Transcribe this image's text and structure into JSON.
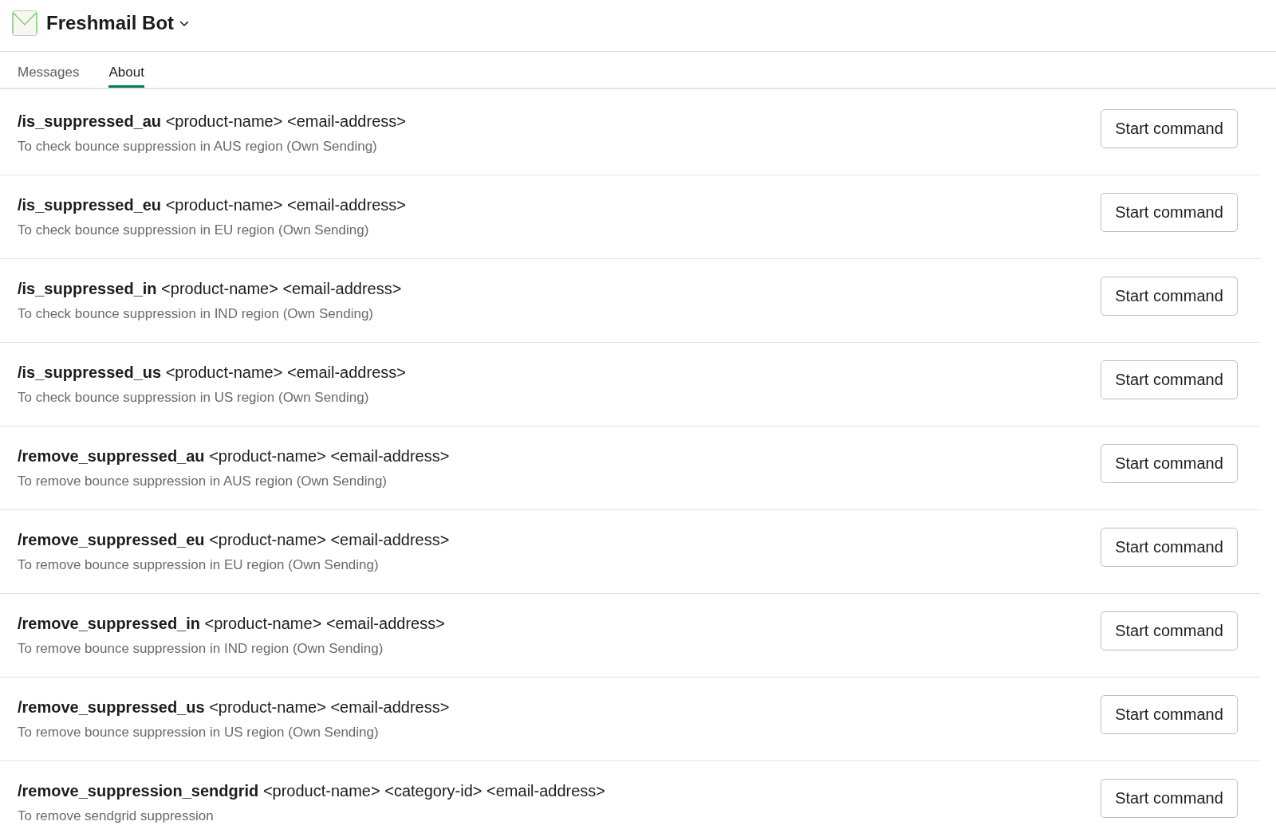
{
  "header": {
    "title": "Freshmail Bot"
  },
  "tabs": [
    {
      "label": "Messages",
      "selected": false
    },
    {
      "label": "About",
      "selected": true
    }
  ],
  "commands": [
    {
      "command": "/is_suppressed_au",
      "arguments": "<product-name> <email-address>",
      "description": "To check bounce suppression in AUS region (Own Sending)",
      "button": "Start command"
    },
    {
      "command": "/is_suppressed_eu",
      "arguments": "<product-name> <email-address>",
      "description": "To check bounce suppression in EU region (Own Sending)",
      "button": "Start command"
    },
    {
      "command": "/is_suppressed_in",
      "arguments": "<product-name> <email-address>",
      "description": "To check bounce suppression in IND region (Own Sending)",
      "button": "Start command"
    },
    {
      "command": "/is_suppressed_us",
      "arguments": "<product-name> <email-address>",
      "description": "To check bounce suppression in US region (Own Sending)",
      "button": "Start command"
    },
    {
      "command": "/remove_suppressed_au",
      "arguments": "<product-name> <email-address>",
      "description": "To remove bounce suppression in AUS region (Own Sending)",
      "button": "Start command"
    },
    {
      "command": "/remove_suppressed_eu",
      "arguments": "<product-name> <email-address>",
      "description": "To remove bounce suppression in EU region (Own Sending)",
      "button": "Start command"
    },
    {
      "command": "/remove_suppressed_in",
      "arguments": "<product-name> <email-address>",
      "description": "To remove bounce suppression in IND region (Own Sending)",
      "button": "Start command"
    },
    {
      "command": "/remove_suppressed_us",
      "arguments": "<product-name> <email-address>",
      "description": "To remove bounce suppression in US region (Own Sending)",
      "button": "Start command"
    },
    {
      "command": "/remove_suppression_sendgrid",
      "arguments": "<product-name> <category-id> <email-address>",
      "description": "To remove sendgrid suppression",
      "button": "Start command"
    }
  ]
}
